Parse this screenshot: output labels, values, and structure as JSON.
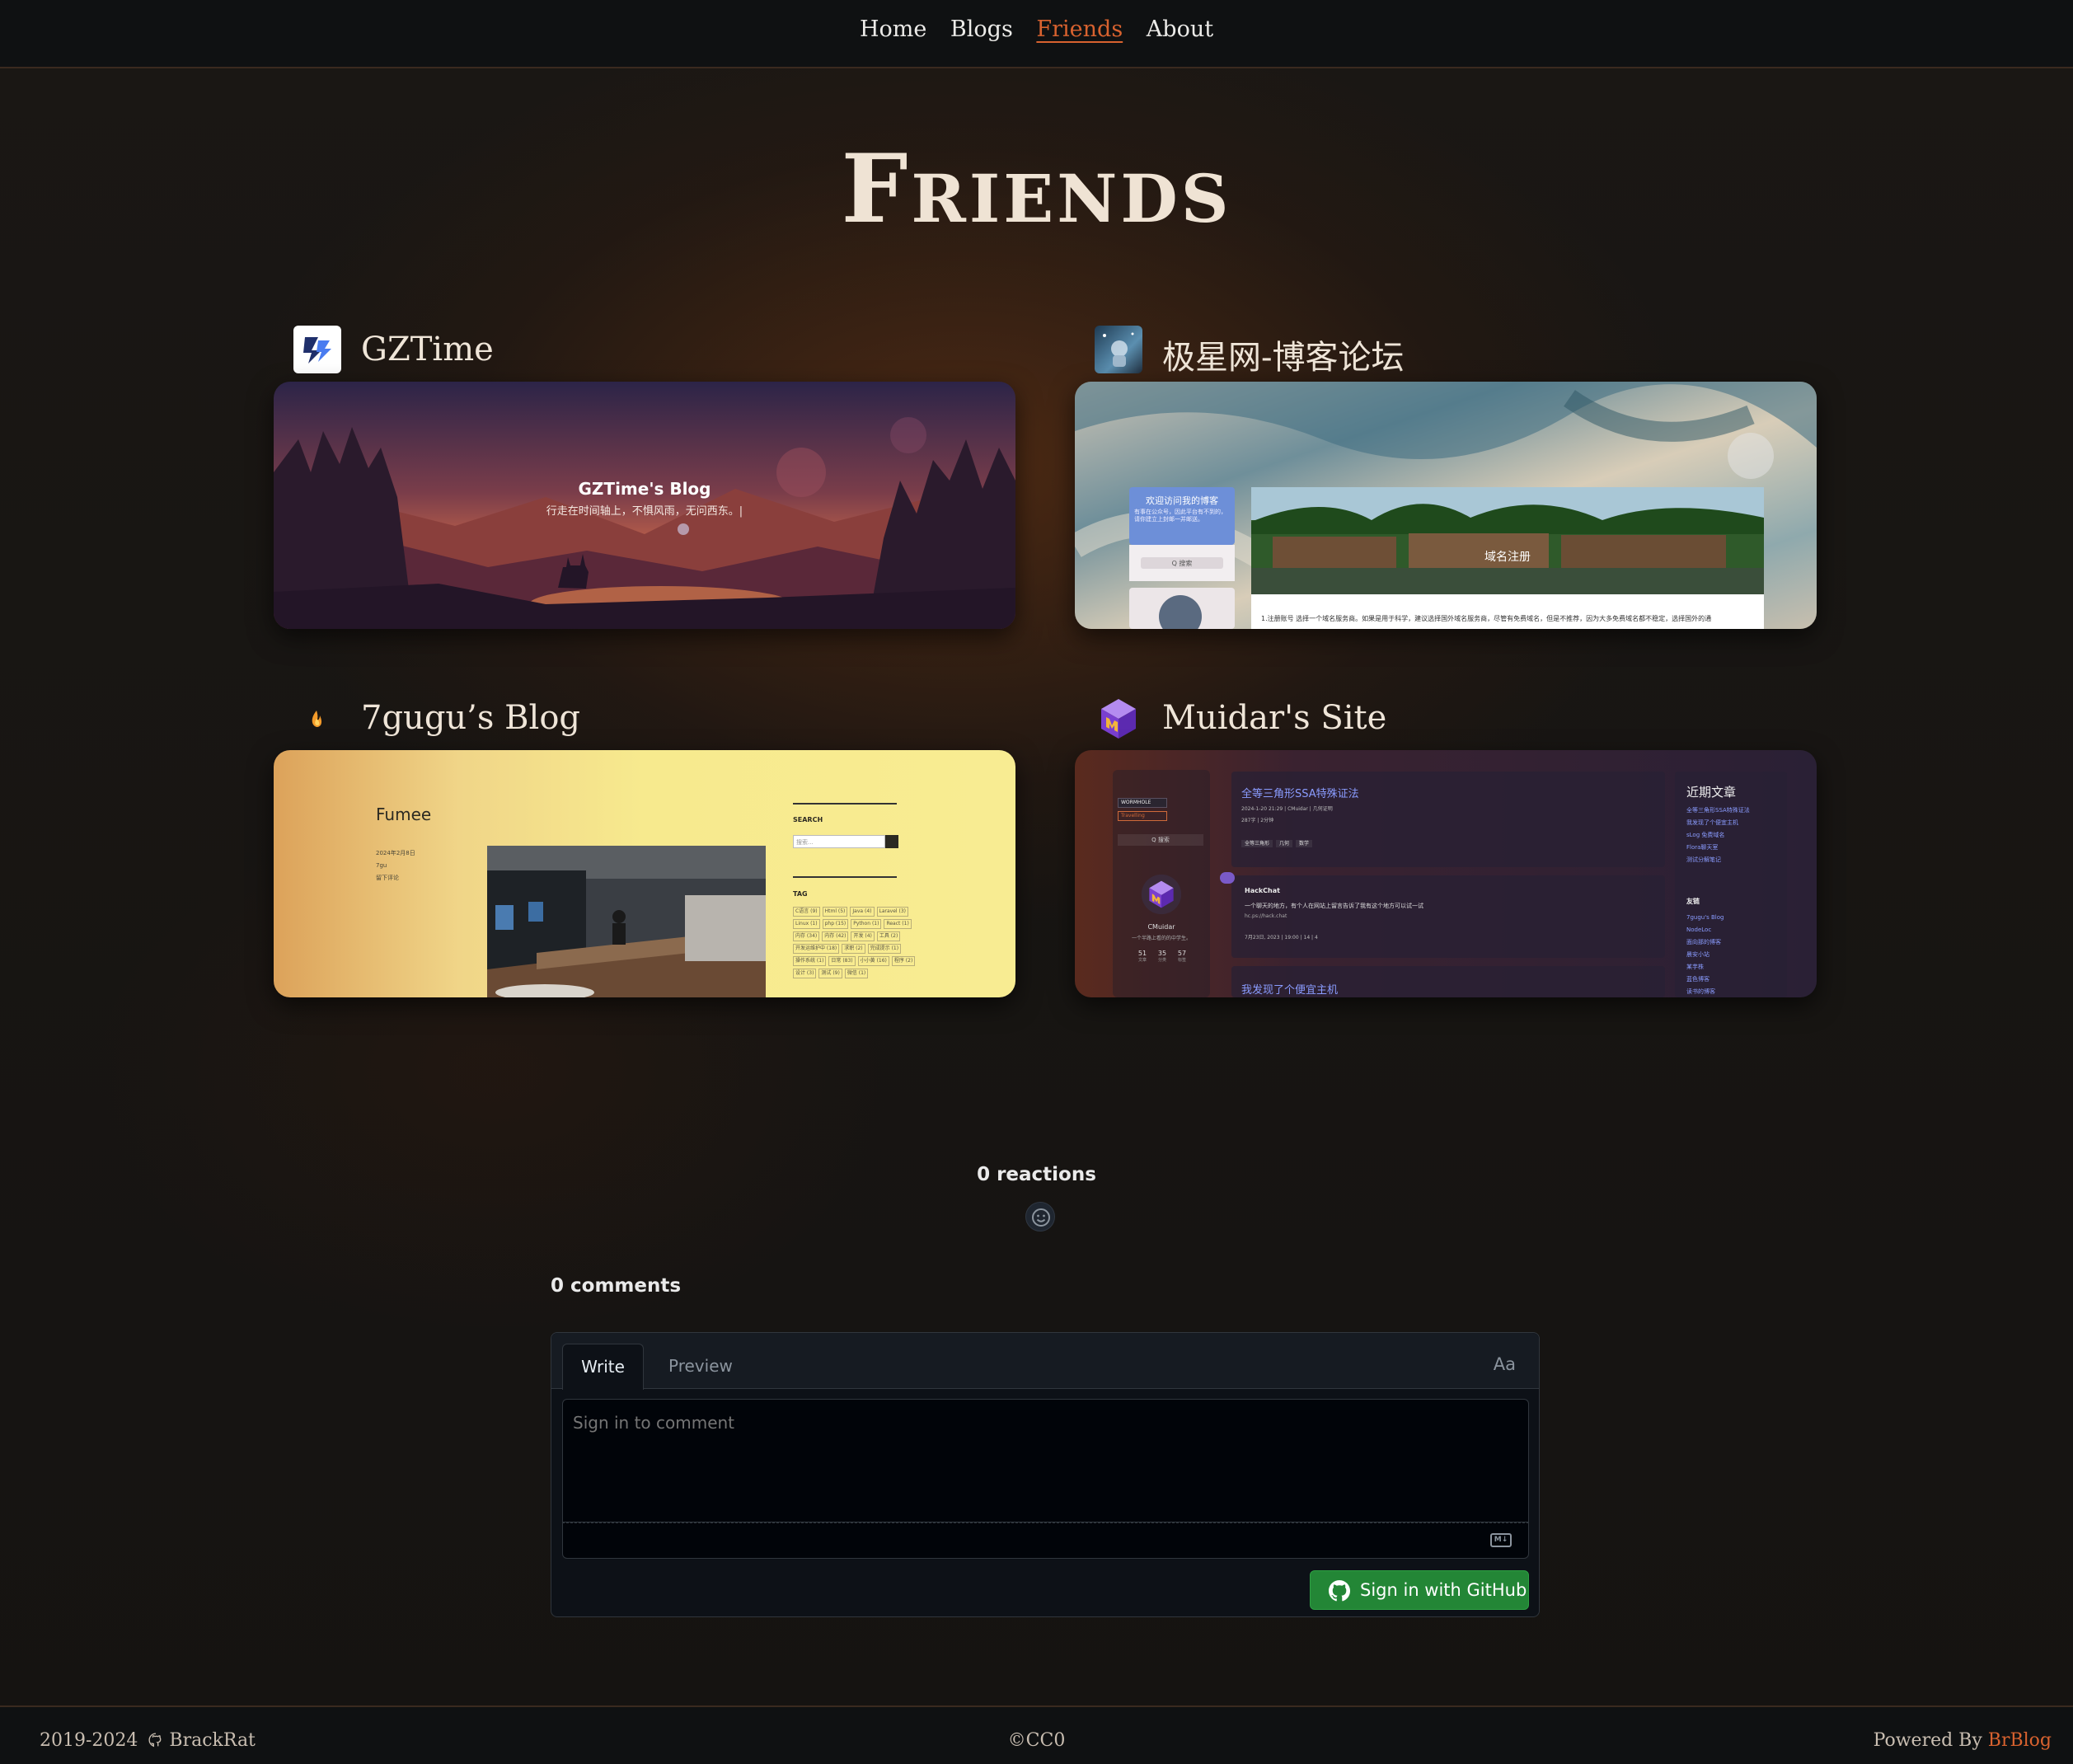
{
  "nav": {
    "items": [
      {
        "label": "Home",
        "active": false
      },
      {
        "label": "Blogs",
        "active": false
      },
      {
        "label": "Friends",
        "active": true
      },
      {
        "label": "About",
        "active": false
      }
    ]
  },
  "page_title": "Friends",
  "friends": [
    {
      "name": "GZTime",
      "logo_icon": "gztime-logo-icon",
      "preview": {
        "title": "GZTime's Blog",
        "subtitle": "行走在时间轴上，不惧风雨，无问西东。|"
      }
    },
    {
      "name": "极星网-博客论坛",
      "logo_icon": "astronaut-avatar-icon",
      "preview": {
        "welcome": "欢迎访问我的博客",
        "welcome_sub": "有事在公众号，因此平台有不到的，请你建立上封邮一并邮送。",
        "search": "Q 搜索",
        "banner_text": "域名注册",
        "body_text": "1.注册账号 选择一个域名服务商。如果是用于科学，建议选择国外域名服务商，尽管有免费域名，但是不推荐，因为大多免费域名都不稳定，选择国外的通"
      }
    },
    {
      "name": "7gugu’s Blog",
      "logo_icon": "flame-icon",
      "preview": {
        "site_name": "Fumee",
        "meta": [
          "2024年2月8日",
          "7gu",
          "留下评论"
        ],
        "search_title": "SEARCH",
        "search_placeholder": "搜索...",
        "tag_title": "TAG",
        "tags": [
          "C语言 (9)",
          "Html (5)",
          "Java (4)",
          "Laravel (3)",
          "Linux (1)",
          "php (15)",
          "Python (1)",
          "React (1)",
          "内存 (34)",
          "内存 (42)",
          "开发 (4)",
          "工具 (2)",
          "开发运维护中 (18)",
          "求职 (2)",
          "完成提示 (1)",
          "操作系统 (1)",
          "日常 (83)",
          "小小黄 (16)",
          "程序 (2)",
          "设计 (3)",
          "测试 (9)",
          "微信 (1)"
        ]
      }
    },
    {
      "name": "Muidar's Site",
      "logo_icon": "cube-logo-icon",
      "preview": {
        "badge_1": "WORMHOLE",
        "badge_2": "Travelling",
        "search": "Q 搜索",
        "author": "CMuidar",
        "tagline": "一个半路上看的的中学生。",
        "stats": [
          {
            "value": "51",
            "label": "文章"
          },
          {
            "value": "35",
            "label": "分类"
          },
          {
            "value": "57",
            "label": "标签"
          }
        ],
        "post_title": "全等三角形SSA特殊证法",
        "post_meta": "2024-1-20 21:29 | CMuidar | 几何证明",
        "post_meta_2": "287字 | 2分钟",
        "post_tags": [
          "全等三角形",
          "几何",
          "数学"
        ],
        "hack_title": "HackChat",
        "hack_text": "一个聊天的地方，有个人在网站上留言告诉了我有这个地方可以试一试",
        "hack_link": "hc.ps://hack.chat",
        "hack_meta": "7月23日, 2023 | 19:00 | 14 | 4",
        "post_title_2": "我发现了个便宜主机",
        "recent_title": "近期文章",
        "recent_items": [
          "全等三角形SSA特殊证法",
          "我发现了个便宜主机",
          "sLog 免费域名",
          "Flora聊天室",
          "测试分解笔记"
        ],
        "links_title": "友链",
        "links": [
          "7gugu's Blog",
          "NodeLoc",
          "面向那的博客",
          "晨安小站",
          "某芋株",
          "蓝色博客",
          "读书的博客"
        ]
      }
    }
  ],
  "comments": {
    "reactions": "0 reactions",
    "count": "0 comments",
    "tab_write": "Write",
    "tab_preview": "Preview",
    "font_toggle": "Aa",
    "placeholder": "Sign in to comment",
    "md_label": "M↓",
    "signin": "Sign in with GitHub"
  },
  "footer": {
    "years": "2019-2024",
    "author": "BrackRat",
    "license": "©CC0",
    "powered_prefix": "Powered By",
    "powered_link": "BrBlog"
  },
  "colors": {
    "accent": "#d8622f",
    "github_green": "#238636"
  }
}
